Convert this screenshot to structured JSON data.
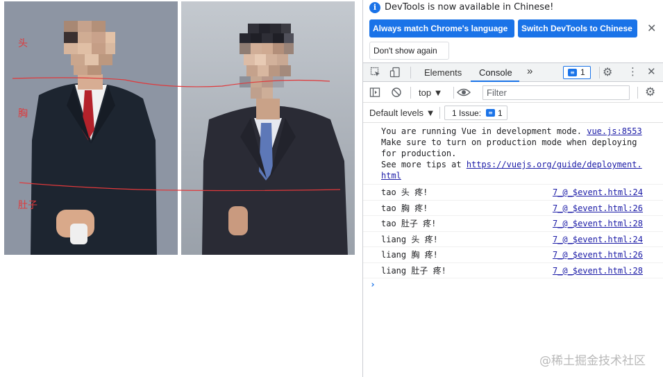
{
  "page": {
    "labels": {
      "head": "头",
      "chest": "胸",
      "belly": "肚子"
    }
  },
  "devtools": {
    "infobar": {
      "message": "DevTools is now available in Chinese!",
      "btn_match": "Always match Chrome's language",
      "btn_switch": "Switch DevTools to Chinese",
      "btn_dismiss": "Don't show again"
    },
    "tabs": {
      "elements": "Elements",
      "console": "Console",
      "more": "»"
    },
    "issues_count": "1",
    "toolbar": {
      "context": "top ▼",
      "filter_placeholder": "Filter"
    },
    "levels": {
      "label": "Default levels ▼",
      "issues_label": "1 Issue:",
      "issues_count": "1"
    },
    "console": {
      "vue_msg": {
        "line1": "You are running Vue in development mode.",
        "source1": "vue.js:8553",
        "line2": "Make sure to turn on production mode when deploying",
        "line3": "for production.",
        "line4_prefix": "See more tips at",
        "line4_link": "https://vuejs.org/guide/deployment.",
        "line5_link": "html"
      },
      "logs": [
        {
          "text": "tao 头 疼!",
          "source": "7_@_$event.html:24"
        },
        {
          "text": "tao 胸 疼!",
          "source": "7_@_$event.html:26"
        },
        {
          "text": "tao 肚子 疼!",
          "source": "7_@_$event.html:28"
        },
        {
          "text": "liang 头 疼!",
          "source": "7_@_$event.html:24"
        },
        {
          "text": "liang 胸 疼!",
          "source": "7_@_$event.html:26"
        },
        {
          "text": "liang 肚子 疼!",
          "source": "7_@_$event.html:28"
        }
      ],
      "prompt": "›"
    }
  },
  "watermark": "@稀土掘金技术社区",
  "colors": {
    "accent": "#1a73e8",
    "label_red": "#e0393b",
    "link": "#1a1aa6"
  }
}
